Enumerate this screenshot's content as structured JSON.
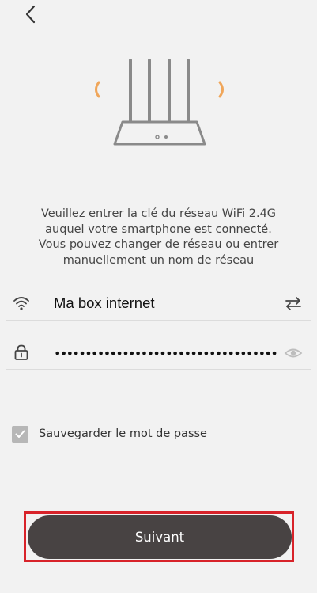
{
  "header": {
    "back_icon": "chevron-left-icon"
  },
  "illustration": {
    "icon": "wifi-router-icon",
    "signal_color": "#f0a65a",
    "router_color": "#8a8a8a"
  },
  "instructions": {
    "lines": [
      "Veuillez entrer la clé du réseau WiFi 2.4G",
      "auquel votre smartphone est connecté.",
      "Vous pouvez changer de réseau ou entrer",
      "manuellement un nom de réseau"
    ]
  },
  "network": {
    "wifi_icon": "wifi-icon",
    "ssid": "Ma box internet",
    "switch_icon": "swap-arrows-icon"
  },
  "password": {
    "lock_icon": "lock-icon",
    "value": "••••••••••••••••••••••••••••••••••••",
    "visibility_icon": "eye-icon"
  },
  "save_password": {
    "label": "Sauvegarder le mot de passe",
    "checked": true,
    "checkbox_color": "#b7b7b7"
  },
  "next_button": {
    "label": "Suivant",
    "bg_color": "#484343",
    "highlight_color": "#d8232a"
  }
}
